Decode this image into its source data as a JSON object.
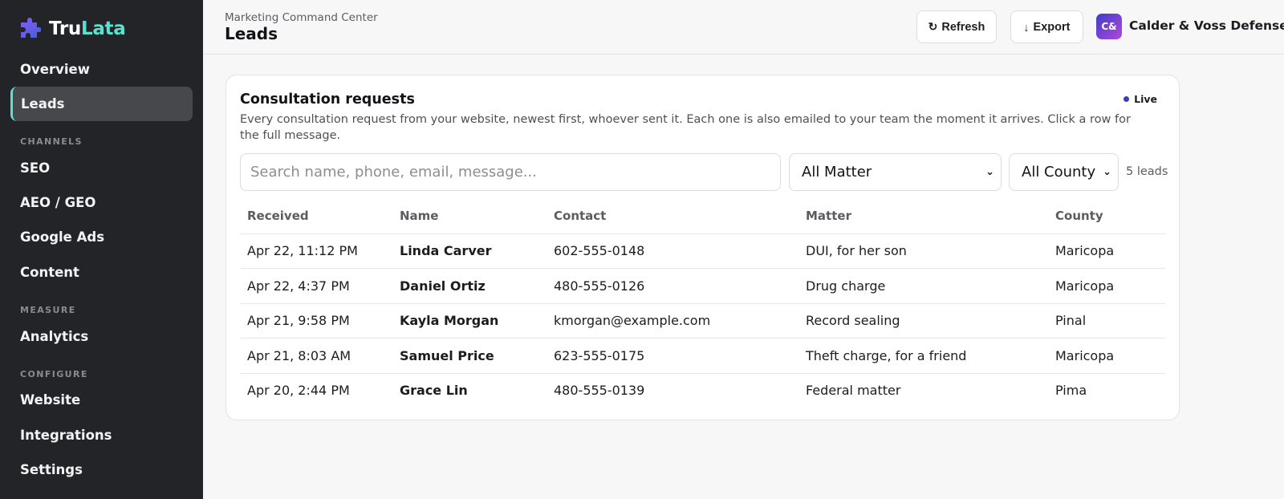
{
  "brand": {
    "part1": "Tru",
    "part2": "Lata"
  },
  "sidebar": {
    "items": [
      {
        "label": "Overview"
      },
      {
        "label": "Leads"
      }
    ],
    "channels_label": "CHANNELS",
    "channels": [
      {
        "label": "SEO"
      },
      {
        "label": "AEO / GEO"
      },
      {
        "label": "Google Ads"
      },
      {
        "label": "Content"
      }
    ],
    "measure_label": "MEASURE",
    "measure": [
      {
        "label": "Analytics"
      }
    ],
    "configure_label": "CONFIGURE",
    "configure": [
      {
        "label": "Website"
      },
      {
        "label": "Integrations"
      },
      {
        "label": "Settings"
      }
    ]
  },
  "header": {
    "breadcrumb": "Marketing Command Center",
    "title": "Leads",
    "refresh_label": "Refresh",
    "export_label": "Export",
    "avatar_initials": "C&",
    "org_name": "Calder & Voss Defense"
  },
  "card": {
    "title": "Consultation requests",
    "live_label": "Live",
    "description": "Every consultation request from your website, newest first, whoever sent it. Each one is also emailed to your team the moment it arrives. Click a row for the full message.",
    "search_placeholder": "Search name, phone, email, message...",
    "matter_filter": "All Matter",
    "county_filter": "All County",
    "count": "5 leads"
  },
  "table": {
    "headers": [
      "Received",
      "Name",
      "Contact",
      "Matter",
      "County"
    ],
    "rows": [
      [
        "Apr 22, 11:12 PM",
        "Linda Carver",
        "602-555-0148",
        "DUI, for her son",
        "Maricopa"
      ],
      [
        "Apr 22, 4:37 PM",
        "Daniel Ortiz",
        "480-555-0126",
        "Drug charge",
        "Maricopa"
      ],
      [
        "Apr 21, 9:58 PM",
        "Kayla Morgan",
        "kmorgan@example.com",
        "Record sealing",
        "Pinal"
      ],
      [
        "Apr 21, 8:03 AM",
        "Samuel Price",
        "623-555-0175",
        "Theft charge, for a friend",
        "Maricopa"
      ],
      [
        "Apr 20, 2:44 PM",
        "Grace Lin",
        "480-555-0139",
        "Federal matter",
        "Pima"
      ]
    ]
  }
}
